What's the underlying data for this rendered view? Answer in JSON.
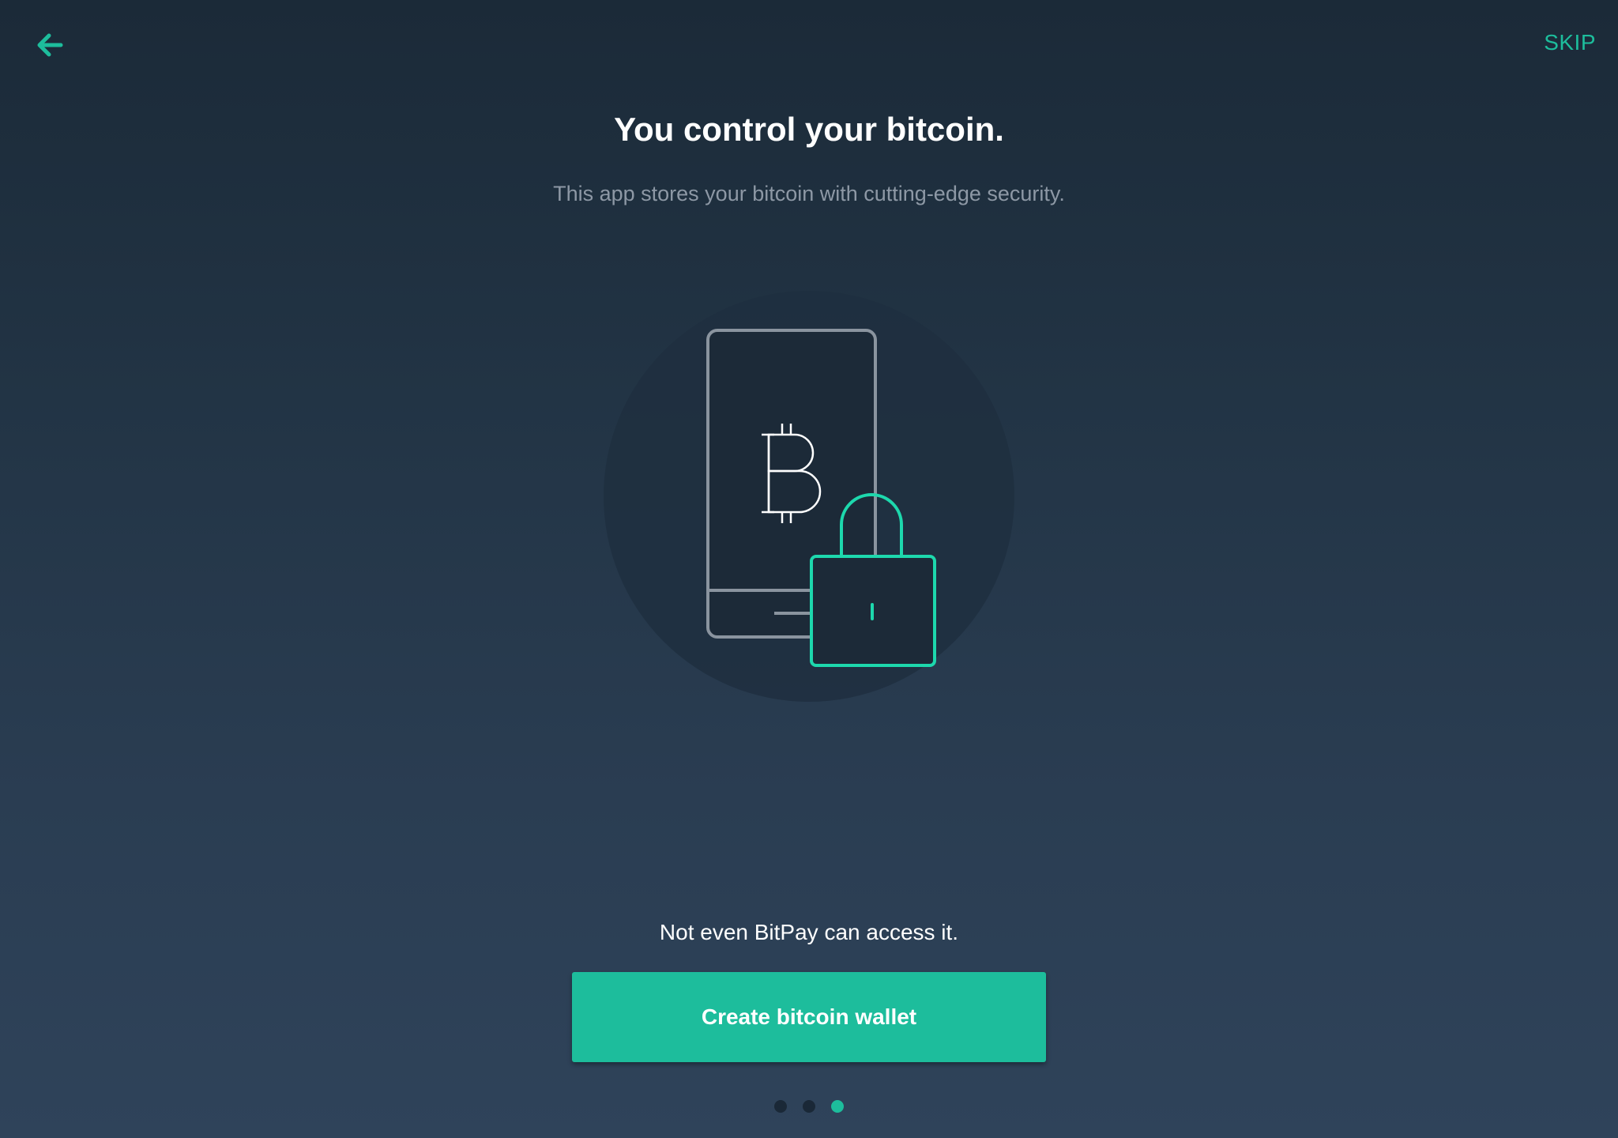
{
  "header": {
    "back_icon": "arrow-left-icon",
    "skip_label": "SKIP"
  },
  "main": {
    "title": "You control your bitcoin.",
    "subtitle": "This app stores your bitcoin with cutting-edge security.",
    "illustration_icons": [
      "phone-icon",
      "bitcoin-icon",
      "padlock-icon"
    ],
    "caption": "Not even BitPay can access it.",
    "primary_button_label": "Create bitcoin wallet"
  },
  "pager": {
    "total_pages": 3,
    "current_page": 3
  },
  "colors": {
    "accent": "#1dbd9c",
    "background_top": "#1b2a38",
    "background_bottom": "#2f435a",
    "muted_text": "#8d98a5"
  }
}
